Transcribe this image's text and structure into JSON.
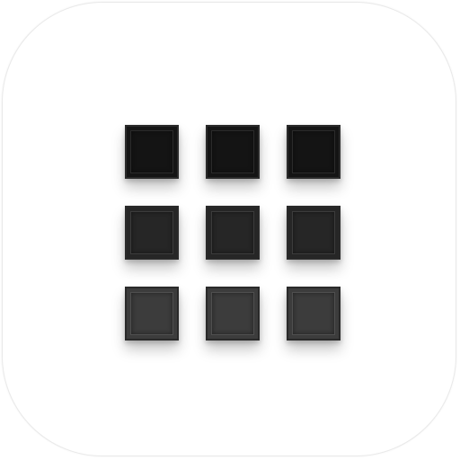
{
  "icon": {
    "name": "grid-app-icon",
    "background_color": "#ffffff",
    "border_color": "#e9e9e9"
  },
  "grid": {
    "rows": 3,
    "columns": 3,
    "row_colors": [
      "#141414",
      "#262626",
      "#3c3c3c"
    ],
    "border_color": "#2a2a2a"
  }
}
